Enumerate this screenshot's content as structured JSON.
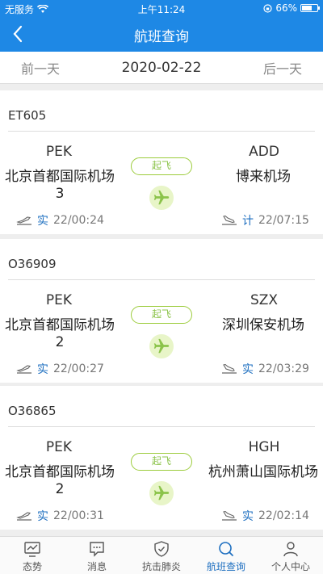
{
  "status_bar": {
    "carrier": "无服务",
    "time": "上午11:24",
    "battery": "66%",
    "battery_level": 0.66
  },
  "nav": {
    "title": "航班查询"
  },
  "date_bar": {
    "prev": "前一天",
    "date": "2020-02-22",
    "next": "后一天"
  },
  "flights": [
    {
      "number": "ET605",
      "dep_code": "PEK",
      "dep_airport": "北京首都国际机场3",
      "arr_code": "ADD",
      "arr_airport": "博来机场",
      "status": "起飞",
      "dep_tag": "实",
      "dep_time": "22/00:24",
      "arr_tag": "计",
      "arr_time": "22/07:15"
    },
    {
      "number": "O36909",
      "dep_code": "PEK",
      "dep_airport": "北京首都国际机场2",
      "arr_code": "SZX",
      "arr_airport": "深圳保安机场",
      "status": "起飞",
      "dep_tag": "实",
      "dep_time": "22/00:27",
      "arr_tag": "实",
      "arr_time": "22/03:29"
    },
    {
      "number": "O36865",
      "dep_code": "PEK",
      "dep_airport": "北京首都国际机场2",
      "arr_code": "HGH",
      "arr_airport": "杭州萧山国际机场",
      "status": "起飞",
      "dep_tag": "实",
      "dep_time": "22/00:31",
      "arr_tag": "实",
      "arr_time": "22/02:14"
    }
  ],
  "tabs": [
    {
      "label": "态势"
    },
    {
      "label": "消息"
    },
    {
      "label": "抗击肺炎"
    },
    {
      "label": "航班查询"
    },
    {
      "label": "个人中心"
    }
  ],
  "colors": {
    "primary": "#1e88e5",
    "status_green": "#8bc34a",
    "tag_blue": "#1e6fc0"
  }
}
